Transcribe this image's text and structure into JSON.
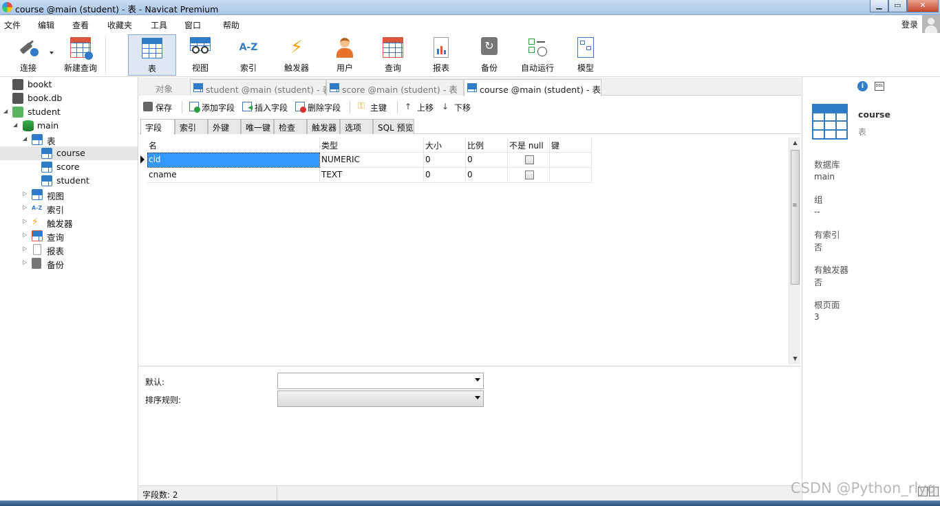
{
  "window": {
    "title": "course @main (student) - 表 - Navicat Premium",
    "min": "▁",
    "max": "▭",
    "close": "✕"
  },
  "menu": {
    "items": [
      "文件",
      "编辑",
      "查看",
      "收藏夹",
      "工具",
      "窗口",
      "帮助"
    ],
    "login": "登录"
  },
  "toolbar": {
    "items": [
      "连接",
      "新建查询",
      "表",
      "视图",
      "索引",
      "触发器",
      "用户",
      "查询",
      "报表",
      "备份",
      "自动运行",
      "模型"
    ],
    "active": "表",
    "index_icon_text": "A-Z"
  },
  "navtree": {
    "rows": [
      {
        "label": "bookt"
      },
      {
        "label": "book.db"
      },
      {
        "label": "student"
      },
      {
        "label": "main"
      },
      {
        "label": "表"
      },
      {
        "label": "course"
      },
      {
        "label": "score"
      },
      {
        "label": "student"
      },
      {
        "label": "视图"
      },
      {
        "label": "索引"
      },
      {
        "label": "触发器"
      },
      {
        "label": "查询"
      },
      {
        "label": "报表"
      },
      {
        "label": "备份"
      }
    ],
    "index_icon_text": "A-Z"
  },
  "tabs": {
    "objects": "对象",
    "items": [
      "student @main (student) - 表",
      "score @main (student) - 表",
      "course @main (student) - 表"
    ]
  },
  "editor_toolbar": {
    "save": "保存",
    "add_field": "添加字段",
    "insert_field": "插入字段",
    "delete_field": "删除字段",
    "primary_key": "主键",
    "move_up": "上移",
    "move_down": "下移"
  },
  "subtabs": [
    "字段",
    "索引",
    "外键",
    "唯一键",
    "检查",
    "触发器",
    "选项",
    "SQL 预览"
  ],
  "grid": {
    "columns": [
      "名",
      "类型",
      "大小",
      "比例",
      "不是 null",
      "键"
    ],
    "rows": [
      {
        "name": "cid",
        "type": "NUMERIC",
        "size": "0",
        "scale": "0"
      },
      {
        "name": "cname",
        "type": "TEXT",
        "size": "0",
        "scale": "0"
      }
    ]
  },
  "props": {
    "default_label": "默认:",
    "collation_label": "排序规则:"
  },
  "status": {
    "field_count": "字段数: 2"
  },
  "rpanel": {
    "info_icon": "i",
    "ddl_icon": "DDL",
    "name": "course",
    "type": "表",
    "db_label": "数据库",
    "db_value": "main",
    "group_label": "组",
    "group_value": "--",
    "has_index_label": "有索引",
    "has_index_value": "否",
    "has_trigger_label": "有触发器",
    "has_trigger_value": "否",
    "root_page_label": "根页面",
    "root_page_value": "3"
  },
  "watermark": "CSDN @Python_rlyq"
}
